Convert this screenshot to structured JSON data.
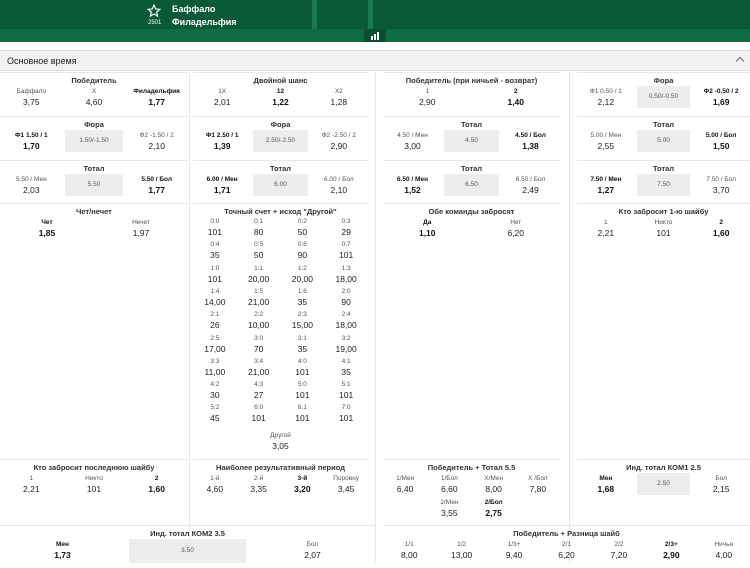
{
  "header": {
    "code": "2501",
    "team1": "Баффало",
    "team2": "Филадельфия"
  },
  "section": {
    "title": "Основное время"
  },
  "winner": {
    "title": "Победитель",
    "items": [
      {
        "l": "Баффало",
        "o": "3,75"
      },
      {
        "l": "Х",
        "o": "4,60"
      },
      {
        "l": "Филадельфия",
        "o": "1,77",
        "b": 1
      }
    ]
  },
  "dbl": {
    "title": "Двойной шанс",
    "items": [
      {
        "l": "1Х",
        "o": "2,01"
      },
      {
        "l": "12",
        "o": "1,22",
        "b": 1
      },
      {
        "l": "Х2",
        "o": "1,28"
      }
    ]
  },
  "dnb": {
    "title": "Победитель (при ничьей - возврат)",
    "items": [
      {
        "l": "1",
        "o": "2,90"
      },
      {
        "l": "2",
        "o": "1,40",
        "b": 1
      }
    ]
  },
  "fora1": {
    "title": "Фора",
    "items": [
      {
        "l": "Ф1 0.50 / 1",
        "o": "2,12"
      },
      {
        "l": "0.50/-0.50"
      },
      {
        "l": "Ф2 -0.50 / 2",
        "o": "1,69",
        "b": 1
      }
    ]
  },
  "fora2": {
    "title": "Фора",
    "items": [
      {
        "l": "Ф1 1.50 / 1",
        "o": "1,70",
        "b": 1
      },
      {
        "l": "1.50/-1.50"
      },
      {
        "l": "Ф2 -1.50 / 2",
        "o": "2,10"
      }
    ]
  },
  "fora3": {
    "title": "Фора",
    "items": [
      {
        "l": "Ф1 2.50 / 1",
        "o": "1,39",
        "b": 1
      },
      {
        "l": "2.50/-2.50"
      },
      {
        "l": "Ф2 -2.50 / 2",
        "o": "2,90"
      }
    ]
  },
  "tot1": {
    "title": "Тотал",
    "items": [
      {
        "l": "4.50 / Мен",
        "o": "3,00"
      },
      {
        "l": "4.50"
      },
      {
        "l": "4.50 / Бол",
        "o": "1,38",
        "b": 1
      }
    ]
  },
  "tot2": {
    "title": "Тотал",
    "items": [
      {
        "l": "5.00 / Мен",
        "o": "2,55"
      },
      {
        "l": "5.00"
      },
      {
        "l": "5.00 / Бол",
        "o": "1,50",
        "b": 1
      }
    ]
  },
  "tot3": {
    "title": "Тотал",
    "items": [
      {
        "l": "5.50 / Мен",
        "o": "2,03"
      },
      {
        "l": "5.50"
      },
      {
        "l": "5.50 / Бол",
        "o": "1,77",
        "b": 1
      }
    ]
  },
  "tot4": {
    "title": "Тотал",
    "items": [
      {
        "l": "6.00 / Мен",
        "o": "1,71",
        "b": 1
      },
      {
        "l": "6.00"
      },
      {
        "l": "6.00 / Бол",
        "o": "2,10"
      }
    ]
  },
  "tot5": {
    "title": "Тотал",
    "items": [
      {
        "l": "6.50 / Мен",
        "o": "1,52",
        "b": 1
      },
      {
        "l": "6.50"
      },
      {
        "l": "6.50 / Бол",
        "o": "2,49"
      }
    ]
  },
  "tot6": {
    "title": "Тотал",
    "items": [
      {
        "l": "7.50 / Мен",
        "o": "1,27",
        "b": 1
      },
      {
        "l": "7.50"
      },
      {
        "l": "7.50 / Бол",
        "o": "3,70"
      }
    ]
  },
  "oddeven": {
    "title": "Чет/нечет",
    "items": [
      {
        "l": "Чет",
        "o": "1,85",
        "b": 1
      },
      {
        "l": "Нечет",
        "o": "1,97"
      }
    ]
  },
  "exact": {
    "title": "Точный счет + исход \"Другой\"",
    "rows": [
      [
        {
          "l": "0:0",
          "o": "101"
        },
        {
          "l": "0:1",
          "o": "80"
        },
        {
          "l": "0:2",
          "o": "50"
        },
        {
          "l": "0:3",
          "o": "29"
        }
      ],
      [
        {
          "l": "0:4",
          "o": "35"
        },
        {
          "l": "0:5",
          "o": "50"
        },
        {
          "l": "0:6",
          "o": "90"
        },
        {
          "l": "0:7",
          "o": "101"
        }
      ],
      [
        {
          "l": "1:0",
          "o": "101"
        },
        {
          "l": "1:1",
          "o": "20,00"
        },
        {
          "l": "1:2",
          "o": "20,00"
        },
        {
          "l": "1:3",
          "o": "18,00"
        }
      ],
      [
        {
          "l": "1:4",
          "o": "14,00"
        },
        {
          "l": "1:5",
          "o": "21,00"
        },
        {
          "l": "1:6",
          "o": "35"
        },
        {
          "l": "2:0",
          "o": "90"
        }
      ],
      [
        {
          "l": "2:1",
          "o": "26"
        },
        {
          "l": "2:2",
          "o": "10,00"
        },
        {
          "l": "2:3",
          "o": "15,00"
        },
        {
          "l": "2:4",
          "o": "18,00"
        }
      ],
      [
        {
          "l": "2:5",
          "o": "17,00"
        },
        {
          "l": "3:0",
          "o": "70"
        },
        {
          "l": "3:1",
          "o": "35"
        },
        {
          "l": "3:2",
          "o": "19,00"
        }
      ],
      [
        {
          "l": "3:3",
          "o": "11,00"
        },
        {
          "l": "3:4",
          "o": "21,00"
        },
        {
          "l": "4:0",
          "o": "101"
        },
        {
          "l": "4:1",
          "o": "35"
        }
      ],
      [
        {
          "l": "4:2",
          "o": "30"
        },
        {
          "l": "4:3",
          "o": "27"
        },
        {
          "l": "5:0",
          "o": "101"
        },
        {
          "l": "5:1",
          "o": "101"
        }
      ],
      [
        {
          "l": "5:2",
          "o": "45"
        },
        {
          "l": "6:0",
          "o": "101"
        },
        {
          "l": "6:1",
          "o": "101"
        },
        {
          "l": "7:0",
          "o": "101"
        }
      ]
    ],
    "other": {
      "l": "Другой",
      "o": "3,05"
    }
  },
  "bts": {
    "title": "Обе команды забросят",
    "items": [
      {
        "l": "Да",
        "o": "1,10",
        "b": 1
      },
      {
        "l": "Нет",
        "o": "6,20"
      }
    ]
  },
  "first": {
    "title": "Кто забросит 1-ю шайбу",
    "items": [
      {
        "l": "1",
        "o": "2,21"
      },
      {
        "l": "Никто",
        "o": "101"
      },
      {
        "l": "2",
        "o": "1,60",
        "b": 1
      }
    ]
  },
  "last": {
    "title": "Кто забросит последнюю шайбу",
    "items": [
      {
        "l": "1",
        "o": "2,21"
      },
      {
        "l": "Никто",
        "o": "101"
      },
      {
        "l": "2",
        "o": "1,60",
        "b": 1
      }
    ]
  },
  "period": {
    "title": "Наиболее результативный период",
    "items": [
      {
        "l": "1-й",
        "o": "4,60"
      },
      {
        "l": "2-й",
        "o": "3,35"
      },
      {
        "l": "3-й",
        "o": "3,20",
        "b": 1
      },
      {
        "l": "Поровну",
        "o": "3,45"
      }
    ]
  },
  "wt": {
    "title": "Победитель + Тотал 5.5",
    "row1": [
      {
        "l": "1/Мен",
        "o": "6,40"
      },
      {
        "l": "1/Бол",
        "o": "6,60"
      },
      {
        "l": "Х/Мен",
        "o": "8,00"
      },
      {
        "l": "Х /Бол",
        "o": "7,80"
      }
    ],
    "row2": [
      {
        "l": "2/Мен",
        "o": "3,55"
      },
      {
        "l": "2/Бол",
        "o": "2,75",
        "b": 1
      }
    ]
  },
  "it1": {
    "title": "Инд. тотал КОМ1 2.5",
    "items": [
      {
        "l": "Мен",
        "o": "1,68",
        "b": 1
      },
      {
        "l": "2.50"
      },
      {
        "l": "Бол",
        "o": "2,15"
      }
    ]
  },
  "it2": {
    "title": "Инд. тотал КОМ2 3.5",
    "items": [
      {
        "l": "Мен",
        "o": "1,73",
        "b": 1
      },
      {
        "l": "3.50"
      },
      {
        "l": "Бол",
        "o": "2,07"
      }
    ]
  },
  "wd": {
    "title": "Победитель + Разница шайб",
    "items": [
      {
        "l": "1/1",
        "o": "8,00"
      },
      {
        "l": "1/2",
        "o": "13,00"
      },
      {
        "l": "1/3+",
        "o": "9,40"
      },
      {
        "l": "2/1",
        "o": "6,20"
      },
      {
        "l": "2/2",
        "o": "7,20"
      },
      {
        "l": "2/3+",
        "o": "2,90",
        "b": 1
      },
      {
        "l": "Ничья",
        "o": "4,00"
      }
    ]
  }
}
